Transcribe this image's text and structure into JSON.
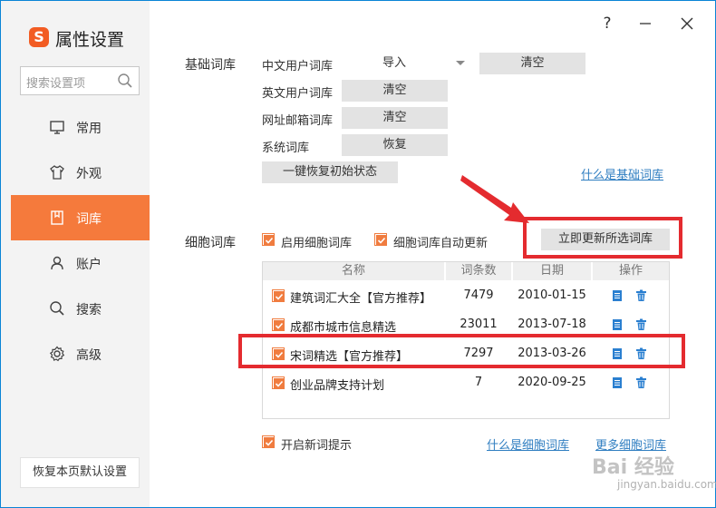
{
  "app": {
    "title": "属性设置",
    "logo_glyph": "S"
  },
  "titlebar": {
    "help": "?"
  },
  "sidebar": {
    "search_placeholder": "搜索设置项",
    "items": [
      {
        "label": "常用",
        "icon": "monitor-icon",
        "active": false
      },
      {
        "label": "外观",
        "icon": "shirt-icon",
        "active": false
      },
      {
        "label": "词库",
        "icon": "book-icon",
        "active": true
      },
      {
        "label": "账户",
        "icon": "user-icon",
        "active": false
      },
      {
        "label": "搜索",
        "icon": "search-icon",
        "active": false
      },
      {
        "label": "高级",
        "icon": "gear-icon",
        "active": false
      }
    ],
    "reset_label": "恢复本页默认设置"
  },
  "basic": {
    "title": "基础词库",
    "rows": [
      {
        "label": "中文用户词库",
        "buttons": [
          "导入",
          "清空"
        ]
      },
      {
        "label": "英文用户词库",
        "buttons": [
          "清空"
        ]
      },
      {
        "label": "网址邮箱词库",
        "buttons": [
          "清空"
        ]
      },
      {
        "label": "系统词库",
        "buttons": [
          "恢复"
        ]
      }
    ],
    "restore_all": "一键恢复初始状态",
    "help_link": "什么是基础词库"
  },
  "cell": {
    "title": "细胞词库",
    "enable_label": "启用细胞词库",
    "auto_update_label": "细胞词库自动更新",
    "update_button": "立即更新所选词库",
    "columns": [
      "名称",
      "词条数",
      "日期",
      "操作"
    ],
    "rows": [
      {
        "name": "建筑词汇大全【官方推荐】",
        "count": "7479",
        "date": "2010-01-15"
      },
      {
        "name": "成都市城市信息精选",
        "count": "23011",
        "date": "2013-07-18"
      },
      {
        "name": "宋词精选【官方推荐】",
        "count": "7297",
        "date": "2013-03-26"
      },
      {
        "name": "创业品牌支持计划",
        "count": "7",
        "date": "2020-09-25"
      }
    ],
    "new_word_tip": "开启新词提示",
    "help_link": "什么是细胞词库",
    "more_link": "更多细胞词库"
  },
  "watermark": {
    "main": "Bai 经验",
    "sub": "jingyan.baidu.com"
  },
  "colors": {
    "accent": "#f57a3c",
    "checkbox": "#f07c3f",
    "link": "#2f7ec1",
    "annotation": "#e42b2f",
    "action_icon": "#2a7fd0"
  }
}
